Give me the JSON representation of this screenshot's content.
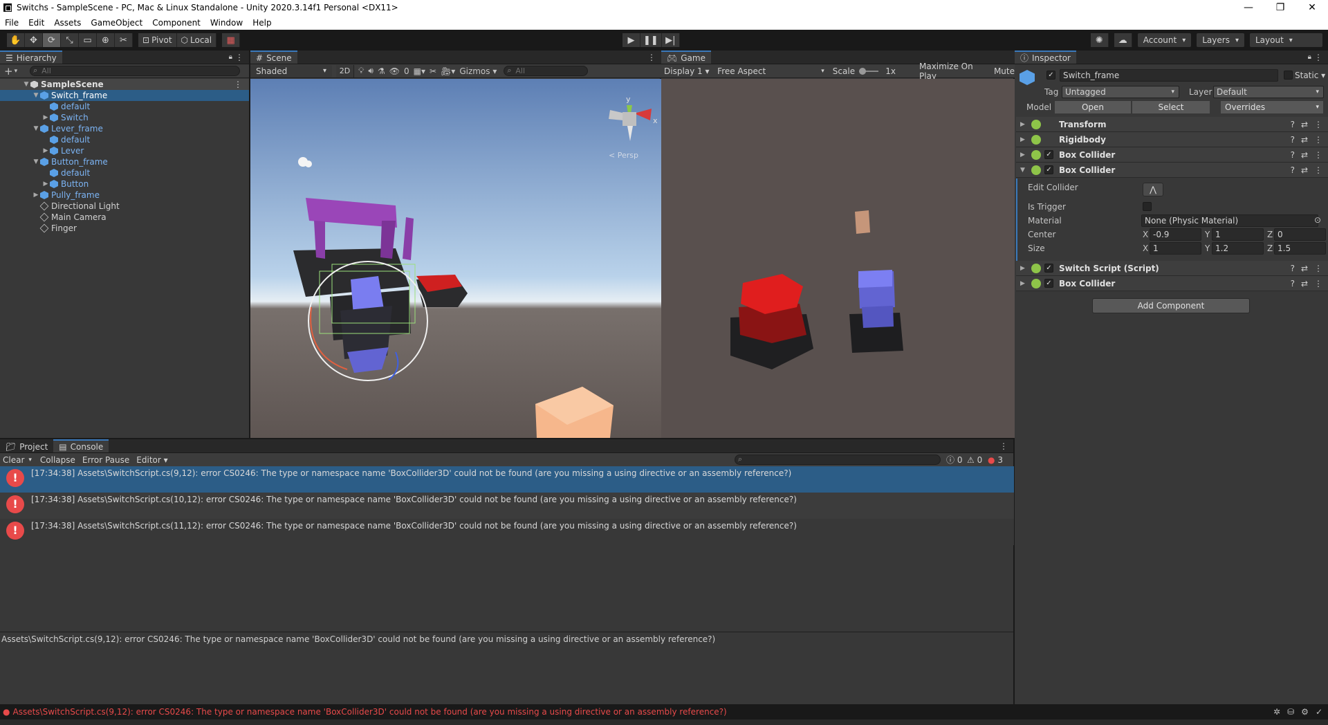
{
  "window": {
    "title": "Switchs - SampleScene - PC, Mac & Linux Standalone - Unity 2020.3.14f1 Personal <DX11>",
    "controls": [
      "—",
      "❐",
      "✕"
    ]
  },
  "menu": [
    "File",
    "Edit",
    "Assets",
    "GameObject",
    "Component",
    "Window",
    "Help"
  ],
  "toolbar": {
    "pivot": "Pivot",
    "local": "Local",
    "account": "Account",
    "layers": "Layers",
    "layout": "Layout"
  },
  "hierarchy": {
    "tab": "Hierarchy",
    "search_placeholder": "All",
    "scene": "SampleScene",
    "items": [
      {
        "label": "Switch_frame",
        "depth": 1,
        "arrow": "▼",
        "icon": "prefab",
        "selected": true
      },
      {
        "label": "default",
        "depth": 2,
        "arrow": "",
        "icon": "prefab-child"
      },
      {
        "label": "Switch",
        "depth": 2,
        "arrow": "▶",
        "icon": "prefab-child"
      },
      {
        "label": "Lever_frame",
        "depth": 1,
        "arrow": "▼",
        "icon": "prefab"
      },
      {
        "label": "default",
        "depth": 2,
        "arrow": "",
        "icon": "prefab-child"
      },
      {
        "label": "Lever",
        "depth": 2,
        "arrow": "▶",
        "icon": "prefab-child"
      },
      {
        "label": "Button_frame",
        "depth": 1,
        "arrow": "▼",
        "icon": "prefab"
      },
      {
        "label": "default",
        "depth": 2,
        "arrow": "",
        "icon": "prefab-child"
      },
      {
        "label": "Button",
        "depth": 2,
        "arrow": "▶",
        "icon": "prefab-child"
      },
      {
        "label": "Pully_frame",
        "depth": 1,
        "arrow": "▶",
        "icon": "prefab"
      },
      {
        "label": "Directional Light",
        "depth": 1,
        "arrow": "",
        "icon": "gameobject"
      },
      {
        "label": "Main Camera",
        "depth": 1,
        "arrow": "",
        "icon": "gameobject"
      },
      {
        "label": "Finger",
        "depth": 1,
        "arrow": "",
        "icon": "gameobject"
      }
    ]
  },
  "scene": {
    "tab": "Scene",
    "shading": "Shaded",
    "mode2d": "2D",
    "hidden_count": "0",
    "gizmos": "Gizmos",
    "search_placeholder": "All",
    "persp": "< Persp",
    "axis_y": "y",
    "axis_x": "x"
  },
  "game": {
    "tab": "Game",
    "display": "Display 1",
    "aspect": "Free Aspect",
    "scale_label": "Scale",
    "scale_value": "1x",
    "maximize": "Maximize On Play",
    "mute": "Mute"
  },
  "inspector": {
    "tab": "Inspector",
    "object_name": "Switch_frame",
    "static_label": "Static",
    "tag_label": "Tag",
    "tag_value": "Untagged",
    "layer_label": "Layer",
    "layer_value": "Default",
    "model_label": "Model",
    "open": "Open",
    "select": "Select",
    "overrides": "Overrides",
    "components": [
      {
        "name": "Transform",
        "checkbox": false
      },
      {
        "name": "Rigidbody",
        "checkbox": false
      },
      {
        "name": "Box Collider",
        "checkbox": true
      },
      {
        "name": "Box Collider",
        "checkbox": true,
        "expanded": true
      }
    ],
    "collider": {
      "edit_collider": "Edit Collider",
      "is_trigger": "Is Trigger",
      "material_label": "Material",
      "material_value": "None (Physic Material)",
      "center_label": "Center",
      "center": {
        "x": "-0.9",
        "y": "1",
        "z": "0"
      },
      "size_label": "Size",
      "size": {
        "x": "1",
        "y": "1.2",
        "z": "1.5"
      }
    },
    "components_after": [
      {
        "name": "Switch Script (Script)"
      },
      {
        "name": "Box Collider"
      }
    ],
    "add_component": "Add Component"
  },
  "bottom": {
    "tab_project": "Project",
    "tab_console": "Console",
    "clear": "Clear",
    "collapse": "Collapse",
    "error_pause": "Error Pause",
    "editor": "Editor",
    "count_info": "0",
    "count_warn": "0",
    "count_err": "3",
    "logs": [
      "[17:34:38] Assets\\SwitchScript.cs(9,12): error CS0246: The type or namespace name 'BoxCollider3D' could not be found (are you missing a using directive or an assembly reference?)",
      "[17:34:38] Assets\\SwitchScript.cs(10,12): error CS0246: The type or namespace name 'BoxCollider3D' could not be found (are you missing a using directive or an assembly reference?)",
      "[17:34:38] Assets\\SwitchScript.cs(11,12): error CS0246: The type or namespace name 'BoxCollider3D' could not be found (are you missing a using directive or an assembly reference?)"
    ],
    "detail": "Assets\\SwitchScript.cs(9,12): error CS0246: The type or namespace name 'BoxCollider3D' could not be found (are you missing a using directive or an assembly reference?)"
  },
  "status": {
    "message": "Assets\\SwitchScript.cs(9,12): error CS0246: The type or namespace name 'BoxCollider3D' could not be found (are you missing a using directive or an assembly reference?)",
    "color": "#e84a4a"
  },
  "colors": {
    "selection": "#2c5d87",
    "accent": "#3a79bb",
    "error": "#e84a4a"
  }
}
